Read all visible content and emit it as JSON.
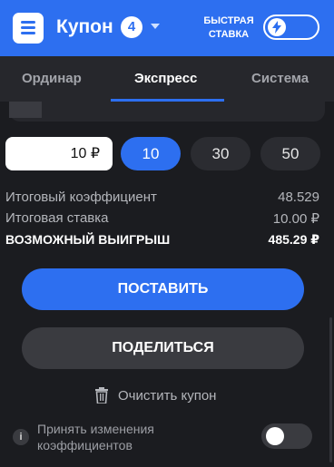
{
  "header": {
    "title": "Купон",
    "count": "4",
    "fast_bet_label": "БЫСТРАЯ СТАВКА",
    "accent": "#2d6ff0"
  },
  "tabs": [
    {
      "label": "Ординар",
      "active": false
    },
    {
      "label": "Экспресс",
      "active": true
    },
    {
      "label": "Система",
      "active": false
    }
  ],
  "stake": {
    "value": "10 ₽",
    "quick_amounts": [
      "10",
      "30",
      "50"
    ],
    "selected": "10"
  },
  "summary": {
    "total_odds_label": "Итоговый коэффициент",
    "total_odds_value": "48.529",
    "total_stake_label": "Итоговая ставка",
    "total_stake_value": "10.00 ₽",
    "possible_win_label": "ВОЗМОЖНЫЙ ВЫИГРЫШ",
    "possible_win_value": "485.29 ₽"
  },
  "actions": {
    "place_label": "ПОСТАВИТЬ",
    "share_label": "ПОДЕЛИТЬСЯ",
    "clear_label": "Очистить купон"
  },
  "settings": {
    "accept_changes_label": "Принять изменения коэффициентов",
    "info_icon": "i"
  }
}
